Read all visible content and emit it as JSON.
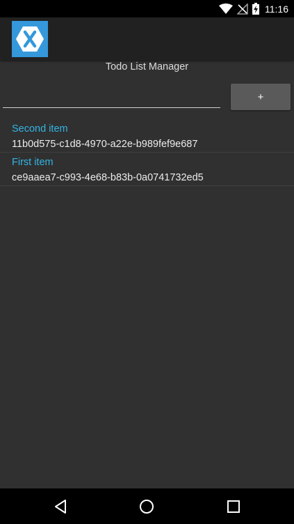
{
  "status_bar": {
    "time": "11:16",
    "icons": [
      "wifi-icon",
      "no-signal-icon",
      "battery-charging-icon"
    ]
  },
  "action_bar": {
    "logo_icon": "xamarin-logo-icon",
    "logo_color": "#3498db"
  },
  "page": {
    "title": "Todo List Manager"
  },
  "form": {
    "input_value": "",
    "input_placeholder": "",
    "add_label": "+"
  },
  "items": [
    {
      "title": "Second item",
      "id": "11b0d575-c1d8-4970-a22e-b989fef9e687"
    },
    {
      "title": "First item",
      "id": "ce9aaea7-c993-4e68-b83b-0a0741732ed5"
    }
  ],
  "colors": {
    "item_title": "#33b5e5",
    "background": "#303030"
  },
  "nav_bar": {
    "icons": [
      "back-icon",
      "home-icon",
      "recents-icon"
    ]
  }
}
